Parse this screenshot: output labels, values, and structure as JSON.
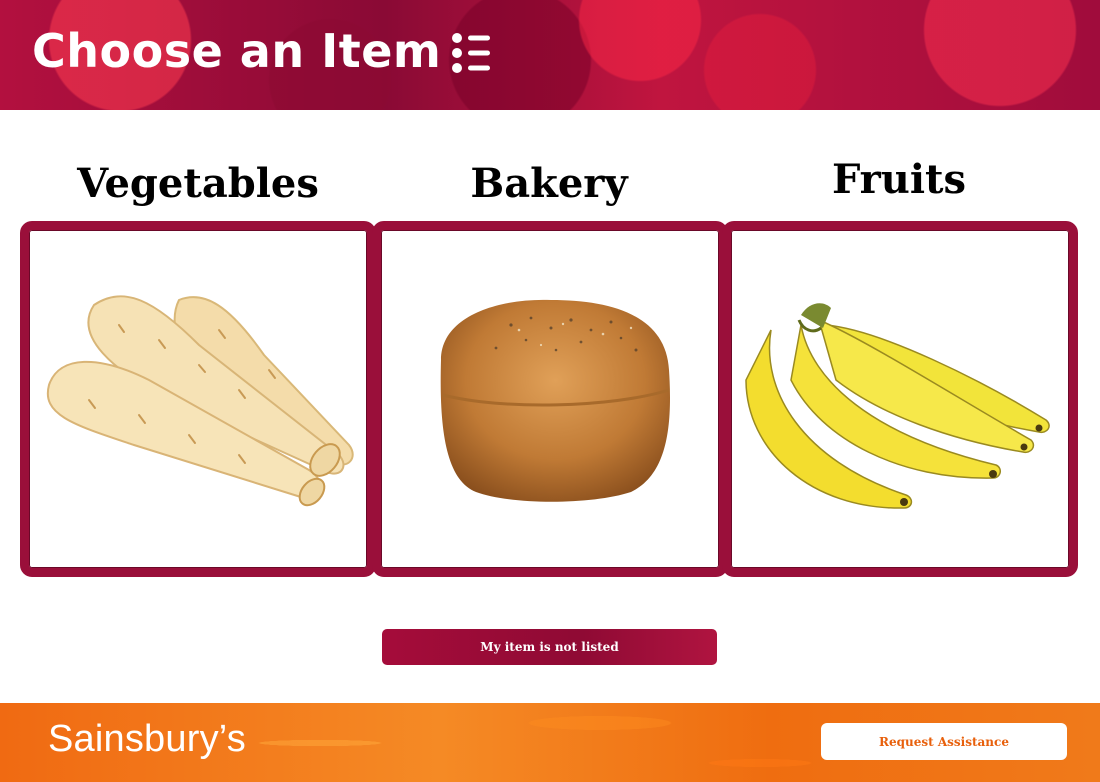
{
  "header": {
    "title": "Choose an Item",
    "menu_icon": "list-menu-icon"
  },
  "categories": [
    {
      "title": "Vegetables",
      "image": "parsnips"
    },
    {
      "title": "Bakery",
      "image": "bread-loaf"
    },
    {
      "title": "Fruits",
      "image": "bananas"
    }
  ],
  "actions": {
    "not_listed_label": "My item is not listed"
  },
  "footer": {
    "brand": "Sainsbury’s",
    "assist_label": "Request Assistance"
  },
  "colors": {
    "brand_red": "#9a0f3a",
    "brand_orange": "#f06a12",
    "assist_text": "#e8600c"
  }
}
